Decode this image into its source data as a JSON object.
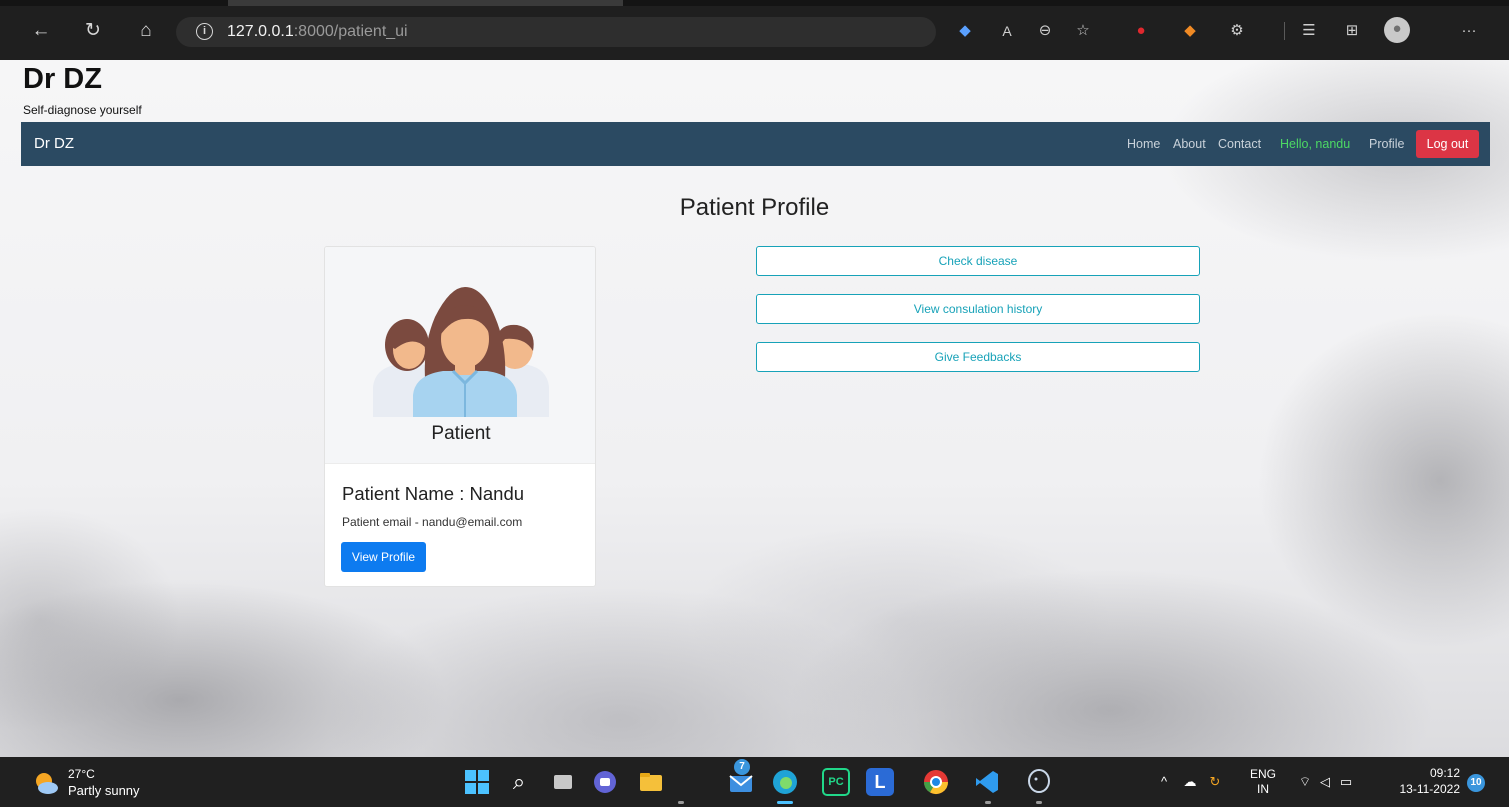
{
  "browser": {
    "url_host": "127.0.0.1",
    "url_rest": ":8000/patient_ui",
    "more_label": "···"
  },
  "site": {
    "title": "Dr DZ",
    "tagline": "Self-diagnose yourself"
  },
  "navbar": {
    "brand": "Dr DZ",
    "links": [
      "Home",
      "About",
      "Contact"
    ],
    "greeting": "Hello, nandu",
    "profile": "Profile",
    "logout": "Log out"
  },
  "main": {
    "heading": "Patient Profile"
  },
  "card": {
    "image_label": "Patient",
    "name": "Patient Name : Nandu",
    "email": "Patient email - nandu@email.com",
    "button": "View Profile"
  },
  "actions": [
    "Check disease",
    "View consulation history",
    "Give Feedbacks"
  ],
  "taskbar": {
    "temperature": "27°C",
    "weather": "Partly sunny",
    "mail_badge": "7",
    "language": "ENG",
    "region": "IN",
    "time": "09:12",
    "date": "13-11-2022",
    "notifications": "10"
  },
  "colors": {
    "navbar": "#2b4a62",
    "greeting": "#4cd964",
    "logout": "#dc3545",
    "primary": "#0d7bf0",
    "outline": "#17a2b8"
  }
}
